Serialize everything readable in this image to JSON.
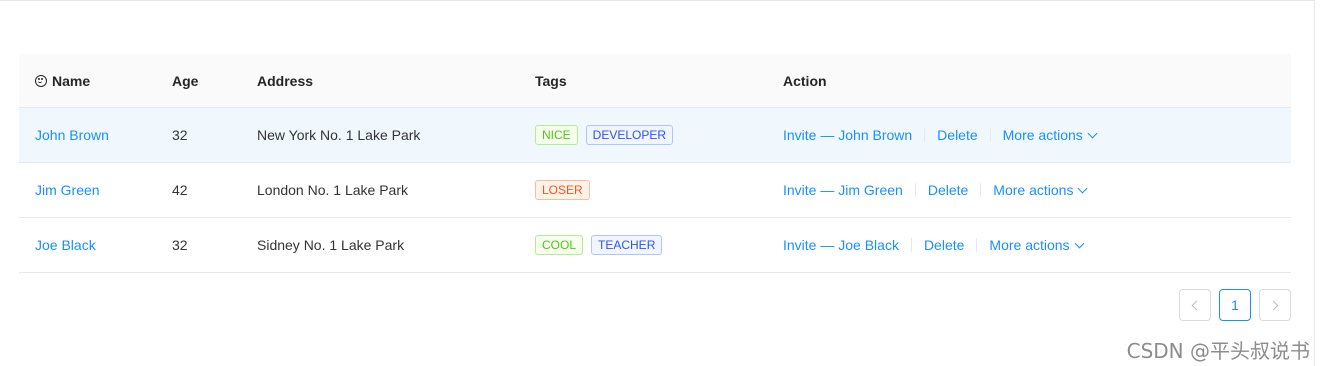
{
  "table": {
    "columns": {
      "name": "Name",
      "age": "Age",
      "address": "Address",
      "tags": "Tags",
      "action": "Action"
    },
    "rows": [
      {
        "name": "John Brown",
        "age": "32",
        "address": "New York No. 1 Lake Park",
        "tags": [
          {
            "label": "NICE",
            "color": "#52c41a",
            "bg": "#f6ffed",
            "border": "#b7eb8f"
          },
          {
            "label": "DEVELOPER",
            "color": "#2f54eb",
            "bg": "#f0f5ff",
            "border": "#adc6ff"
          }
        ],
        "invite": "Invite — John Brown",
        "delete": "Delete",
        "more": "More actions"
      },
      {
        "name": "Jim Green",
        "age": "42",
        "address": "London No. 1 Lake Park",
        "tags": [
          {
            "label": "LOSER",
            "color": "#fa541c",
            "bg": "#fff2e8",
            "border": "#ffbb96"
          }
        ],
        "invite": "Invite — Jim Green",
        "delete": "Delete",
        "more": "More actions"
      },
      {
        "name": "Joe Black",
        "age": "32",
        "address": "Sidney No. 1 Lake Park",
        "tags": [
          {
            "label": "COOL",
            "color": "#52c41a",
            "bg": "#f6ffed",
            "border": "#b7eb8f"
          },
          {
            "label": "TEACHER",
            "color": "#2f54eb",
            "bg": "#f0f5ff",
            "border": "#adc6ff"
          }
        ],
        "invite": "Invite — Joe Black",
        "delete": "Delete",
        "more": "More actions"
      }
    ]
  },
  "pagination": {
    "current_page": "1",
    "prev_icon": "chevron-left-icon",
    "next_icon": "chevron-right-icon"
  },
  "watermark": "CSDN @平头叔说书",
  "colors": {
    "link": "#1890ff",
    "header_bg": "#fafafa",
    "hover_row_bg": "#f0f8fd",
    "border": "#e8e8e8"
  }
}
